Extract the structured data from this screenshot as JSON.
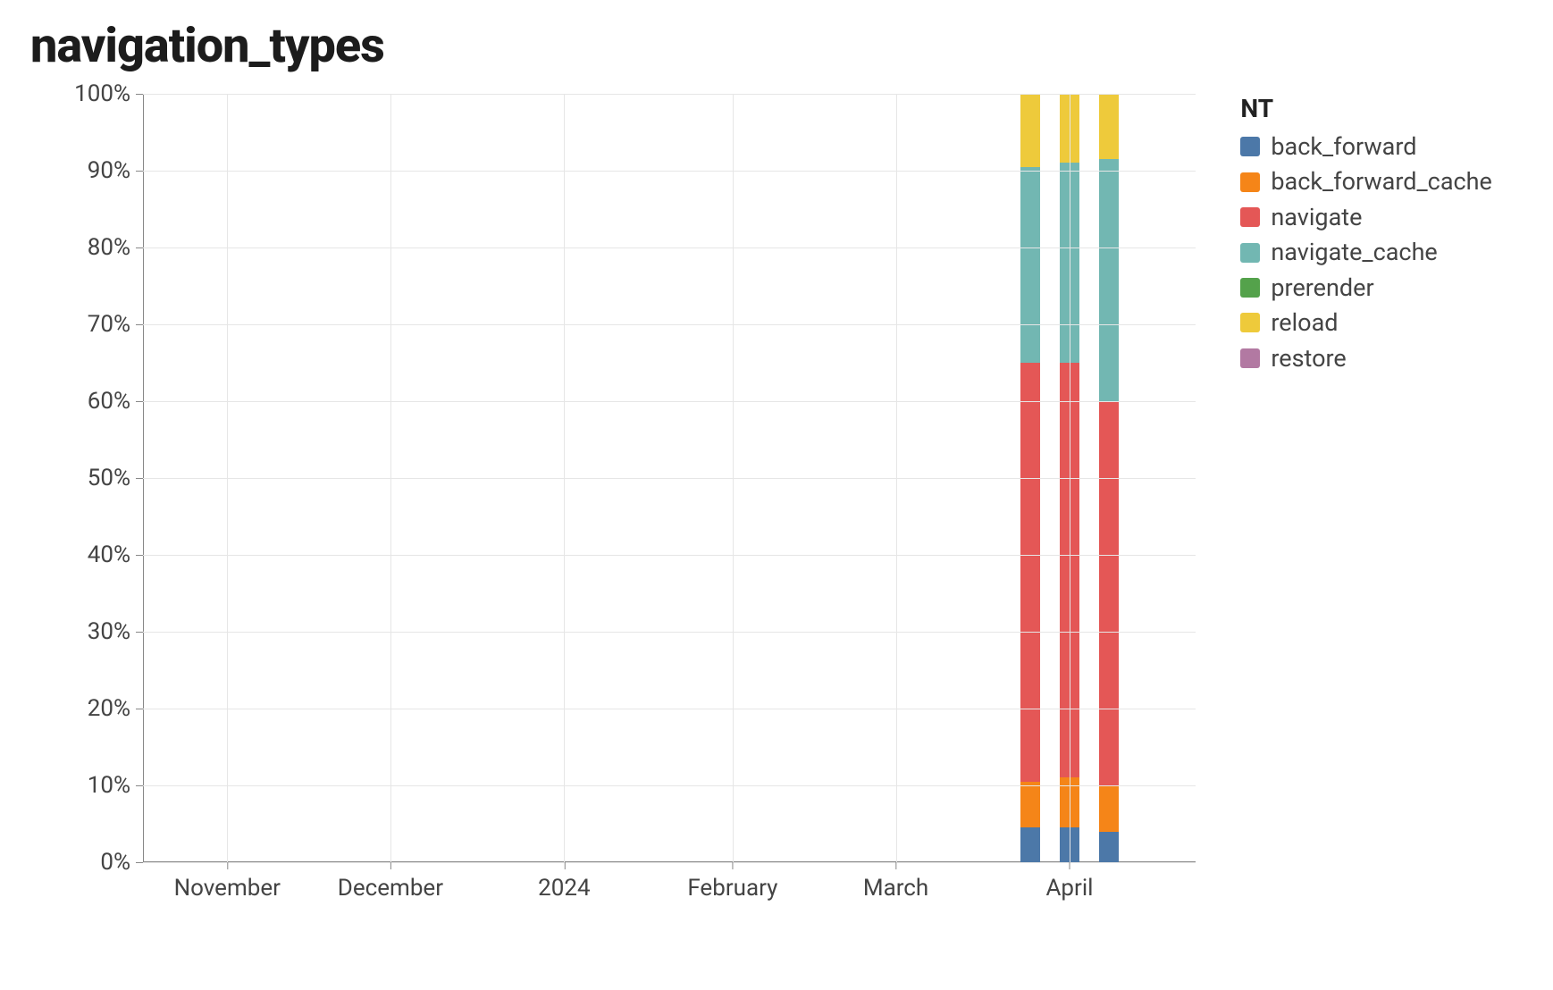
{
  "chart_data": {
    "type": "bar",
    "stacked": true,
    "normalized": true,
    "title": "navigation_types",
    "ylabel": "",
    "xlabel": "",
    "ylim": [
      0,
      100
    ],
    "y_ticks": [
      0,
      10,
      20,
      30,
      40,
      50,
      60,
      70,
      80,
      90,
      100
    ],
    "y_tick_labels": [
      "0%",
      "10%",
      "20%",
      "30%",
      "40%",
      "50%",
      "60%",
      "70%",
      "80%",
      "90%",
      "100%"
    ],
    "x_tick_positions": [
      8,
      23.5,
      40,
      56,
      71.5,
      88
    ],
    "x_tick_labels": [
      "November",
      "December",
      "2024",
      "February",
      "March",
      "April"
    ],
    "legend_title": "NT",
    "legend_entries": [
      {
        "name": "back_forward",
        "color": "#4c78a8"
      },
      {
        "name": "back_forward_cache",
        "color": "#f58518"
      },
      {
        "name": "navigate",
        "color": "#e45756"
      },
      {
        "name": "navigate_cache",
        "color": "#72b7b2"
      },
      {
        "name": "prerender",
        "color": "#54a24b"
      },
      {
        "name": "reload",
        "color": "#eeca3b"
      },
      {
        "name": "restore",
        "color": "#b279a2"
      }
    ],
    "bars": [
      {
        "x_pct": 84.3,
        "segments": [
          {
            "name": "back_forward",
            "value": 4.5,
            "color": "#4c78a8"
          },
          {
            "name": "back_forward_cache",
            "value": 6.0,
            "color": "#f58518"
          },
          {
            "name": "navigate",
            "value": 54.5,
            "color": "#e45756"
          },
          {
            "name": "navigate_cache",
            "value": 25.5,
            "color": "#72b7b2"
          },
          {
            "name": "prerender",
            "value": 0.0,
            "color": "#54a24b"
          },
          {
            "name": "reload",
            "value": 9.5,
            "color": "#eeca3b"
          },
          {
            "name": "restore",
            "value": 0.0,
            "color": "#b279a2"
          }
        ]
      },
      {
        "x_pct": 88.0,
        "segments": [
          {
            "name": "back_forward",
            "value": 4.5,
            "color": "#4c78a8"
          },
          {
            "name": "back_forward_cache",
            "value": 6.5,
            "color": "#f58518"
          },
          {
            "name": "navigate",
            "value": 54.0,
            "color": "#e45756"
          },
          {
            "name": "navigate_cache",
            "value": 26.0,
            "color": "#72b7b2"
          },
          {
            "name": "prerender",
            "value": 0.0,
            "color": "#54a24b"
          },
          {
            "name": "reload",
            "value": 9.0,
            "color": "#eeca3b"
          },
          {
            "name": "restore",
            "value": 0.0,
            "color": "#b279a2"
          }
        ]
      },
      {
        "x_pct": 91.7,
        "segments": [
          {
            "name": "back_forward",
            "value": 4.0,
            "color": "#4c78a8"
          },
          {
            "name": "back_forward_cache",
            "value": 6.0,
            "color": "#f58518"
          },
          {
            "name": "navigate",
            "value": 50.0,
            "color": "#e45756"
          },
          {
            "name": "navigate_cache",
            "value": 31.5,
            "color": "#72b7b2"
          },
          {
            "name": "prerender",
            "value": 0.0,
            "color": "#54a24b"
          },
          {
            "name": "reload",
            "value": 8.5,
            "color": "#eeca3b"
          },
          {
            "name": "restore",
            "value": 0.0,
            "color": "#b279a2"
          }
        ]
      }
    ]
  }
}
